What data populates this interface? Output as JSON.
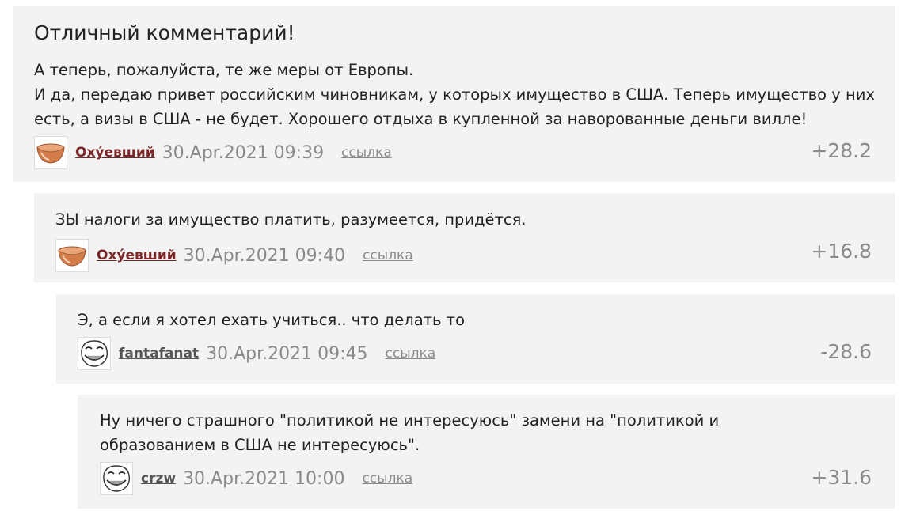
{
  "comments": [
    {
      "title": "Отличный комментарий!",
      "text": "А теперь, пожалуйста, те же меры от Европы.\nИ да, передаю привет российским чиновникам, у которых имущество в США. Теперь имущество у них есть, а визы в США - не будет. Хорошего отдыха в купленной за наворованные деньги вилле!",
      "author": "Охýевший",
      "date": "30.Apr.2021 09:39",
      "link": "ссылка",
      "score": "+28.2",
      "avatar_icon": "copper-bowl-icon"
    },
    {
      "text": "ЗЫ налоги за имущество платить, разумеется, придётся.",
      "author": "Охýевший",
      "date": "30.Apr.2021 09:40",
      "link": "ссылка",
      "score": "+16.8",
      "avatar_icon": "copper-bowl-icon"
    },
    {
      "text": "Э, а если я хотел ехать учиться.. что делать то",
      "author": "fantafanat",
      "date": "30.Apr.2021 09:45",
      "link": "ссылка",
      "score": "-28.6",
      "avatar_icon": "trollface-icon"
    },
    {
      "text": "Ну ничего страшного \"политикой не интересуюсь\" замени на \"политикой и образованием в США не интересуюсь\".",
      "author": "crzw",
      "date": "30.Apr.2021 10:00",
      "link": "ссылка",
      "score": "+31.6",
      "avatar_icon": "trollface-icon"
    }
  ],
  "colors": {
    "author_brown": "#7b2727",
    "author_gray": "#555555",
    "meta_gray": "#8a8a8a",
    "panel_bg": "#f3f3f3"
  }
}
